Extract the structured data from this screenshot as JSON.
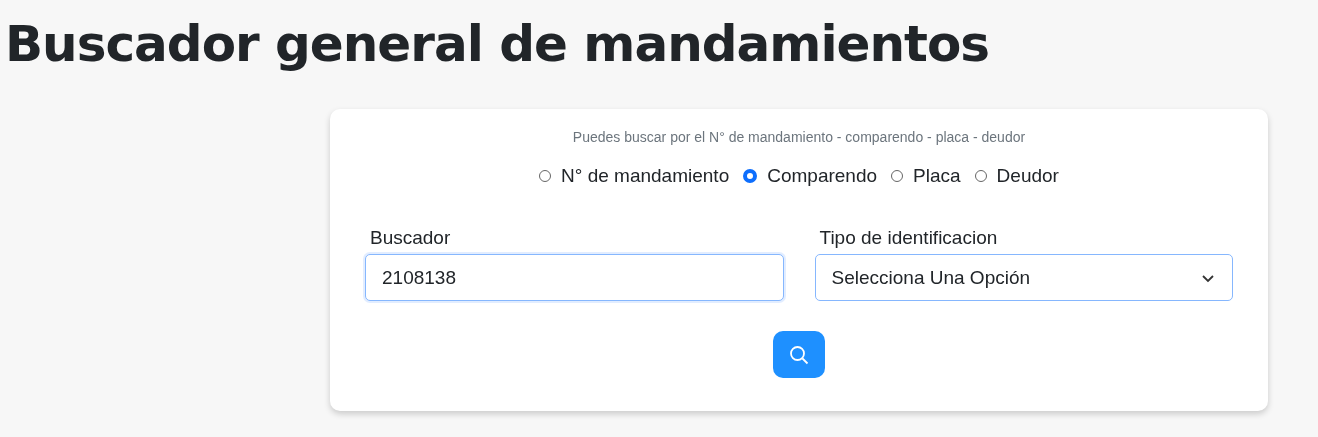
{
  "title": "Buscador general de mandamientos",
  "hint": "Puedes buscar por el N° de mandamiento - comparendo - placa - deudor",
  "search_types": [
    {
      "label": "N° de mandamiento",
      "selected": false
    },
    {
      "label": "Comparendo",
      "selected": true
    },
    {
      "label": "Placa",
      "selected": false
    },
    {
      "label": "Deudor",
      "selected": false
    }
  ],
  "search_field": {
    "label": "Buscador",
    "value": "2108138"
  },
  "id_type": {
    "label": "Tipo de identificacion",
    "value": "Selecciona Una Opción"
  }
}
